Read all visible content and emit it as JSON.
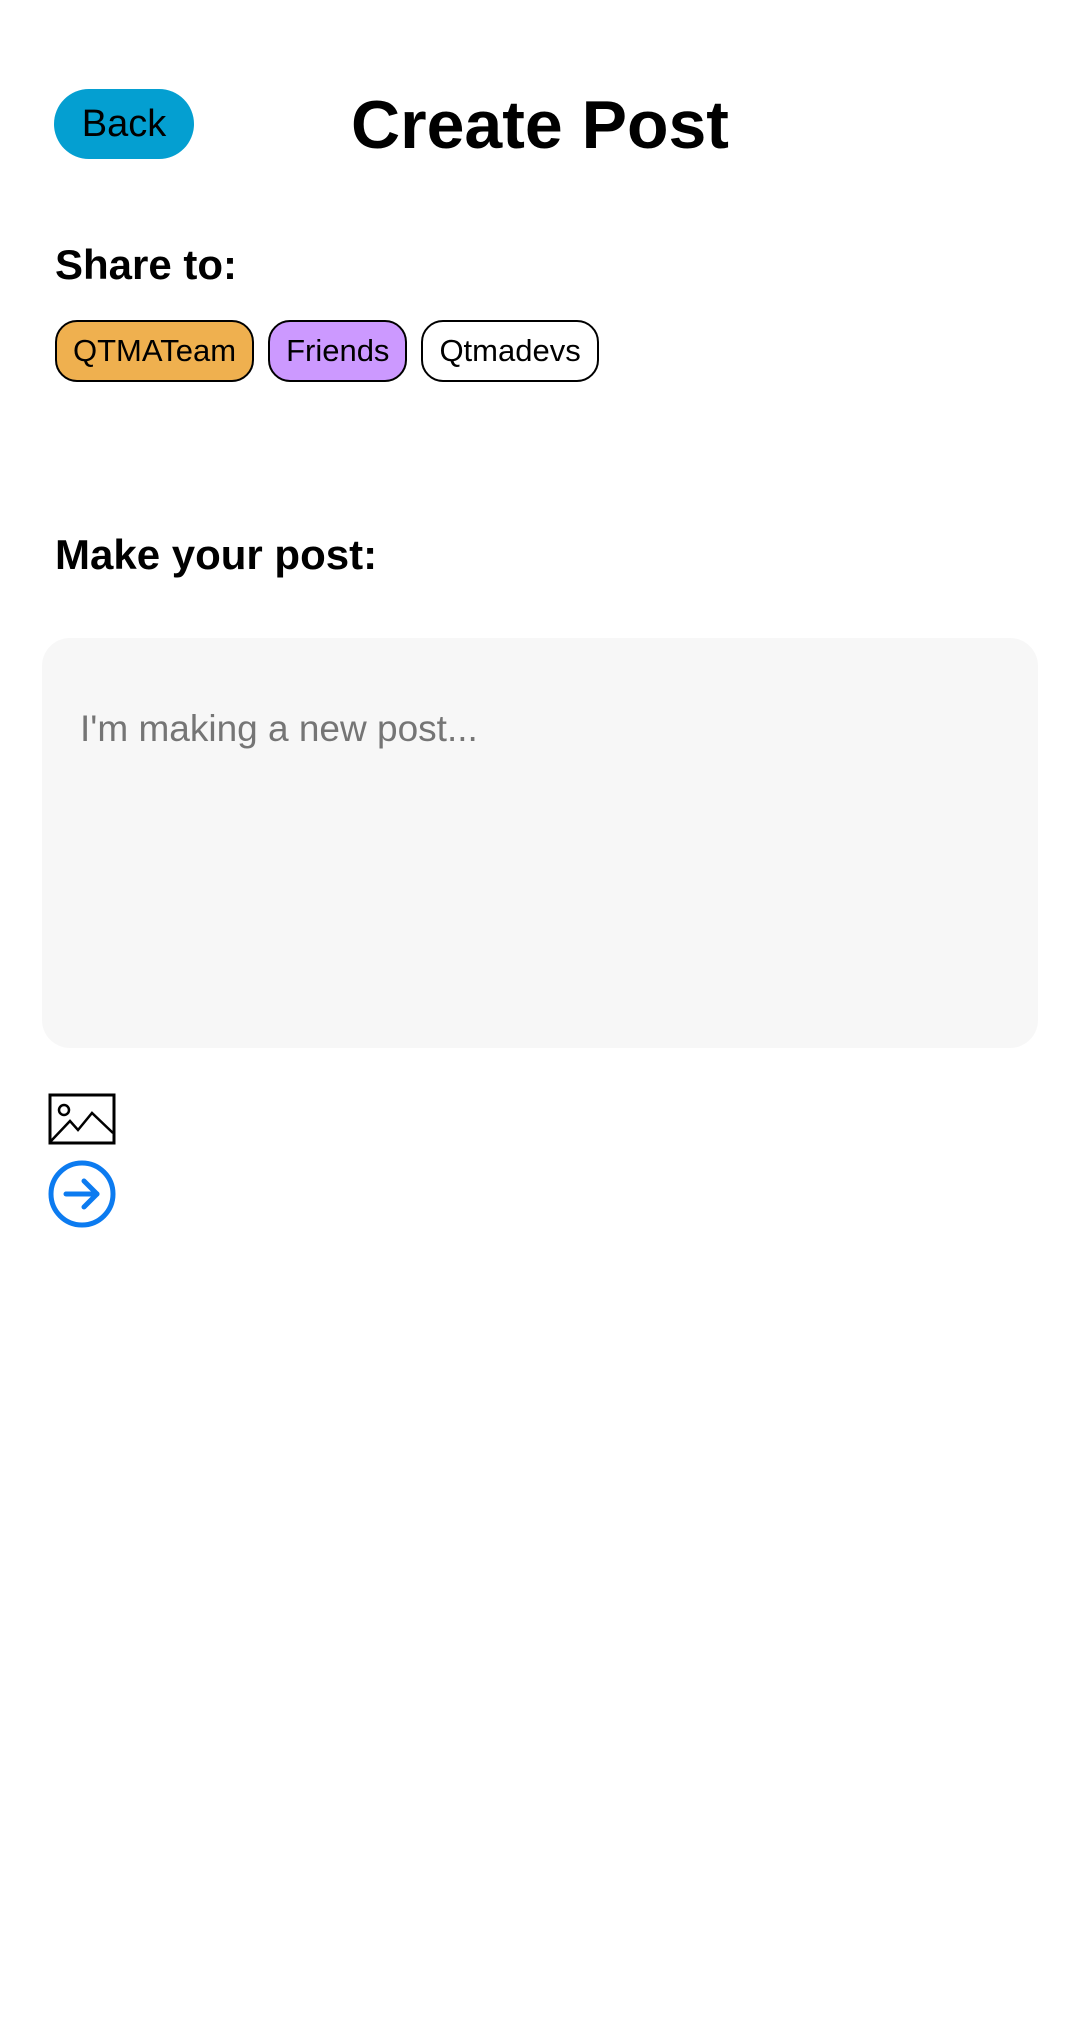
{
  "header": {
    "back_label": "Back",
    "title": "Create Post"
  },
  "share": {
    "label": "Share to:",
    "chips": [
      {
        "label": "QTMATeam",
        "color": "#efb04f",
        "selected": true
      },
      {
        "label": "Friends",
        "color": "#cc99ff",
        "selected": true
      },
      {
        "label": "Qtmadevs",
        "color": "#ffffff",
        "selected": false
      }
    ]
  },
  "post": {
    "label": "Make your post:",
    "placeholder": "I'm making a new post..."
  },
  "actions": {
    "image_icon": "image-icon",
    "send_icon": "arrow-right-circle-icon",
    "accent_color": "#0c7bf0"
  },
  "colors": {
    "back_button": "#049fd1",
    "post_box": "#f7f7f7"
  }
}
